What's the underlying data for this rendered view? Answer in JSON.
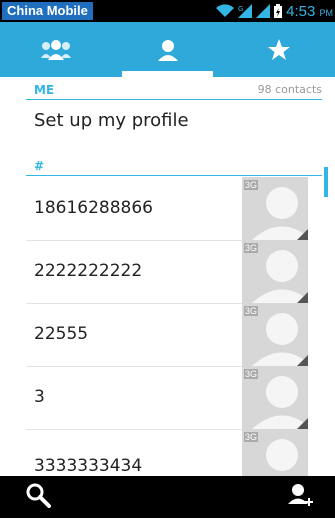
{
  "status_bar": {
    "carrier": "China Mobile",
    "time": "4:53",
    "time_suffix": "PM",
    "icons": [
      "wifi-icon",
      "signal-icon",
      "signal-icon",
      "battery-icon"
    ]
  },
  "tabs": [
    {
      "name": "groups",
      "icon": "group-icon"
    },
    {
      "name": "contacts",
      "icon": "person-icon",
      "active": true
    },
    {
      "name": "favorites",
      "icon": "star-icon"
    }
  ],
  "me_section": {
    "title": "ME",
    "count": "98 contacts"
  },
  "profile": {
    "label": "Set up my profile"
  },
  "hash_section": {
    "title": "#"
  },
  "contacts": [
    {
      "name": "18616288866",
      "badge": "3G"
    },
    {
      "name": "2222222222",
      "badge": "3G"
    },
    {
      "name": "22555",
      "badge": "3G"
    },
    {
      "name": "3",
      "badge": "3G"
    },
    {
      "name": "3333333434",
      "badge": "3G"
    }
  ],
  "bottom_bar": {
    "icons": [
      "search-icon",
      "add-contact-icon"
    ]
  },
  "colors": {
    "accent": "#33b5e5",
    "tab_bg": "#2fa8da",
    "carrier_bg": "#1f6fbe",
    "avatar_bg": "#d7d7d7"
  }
}
